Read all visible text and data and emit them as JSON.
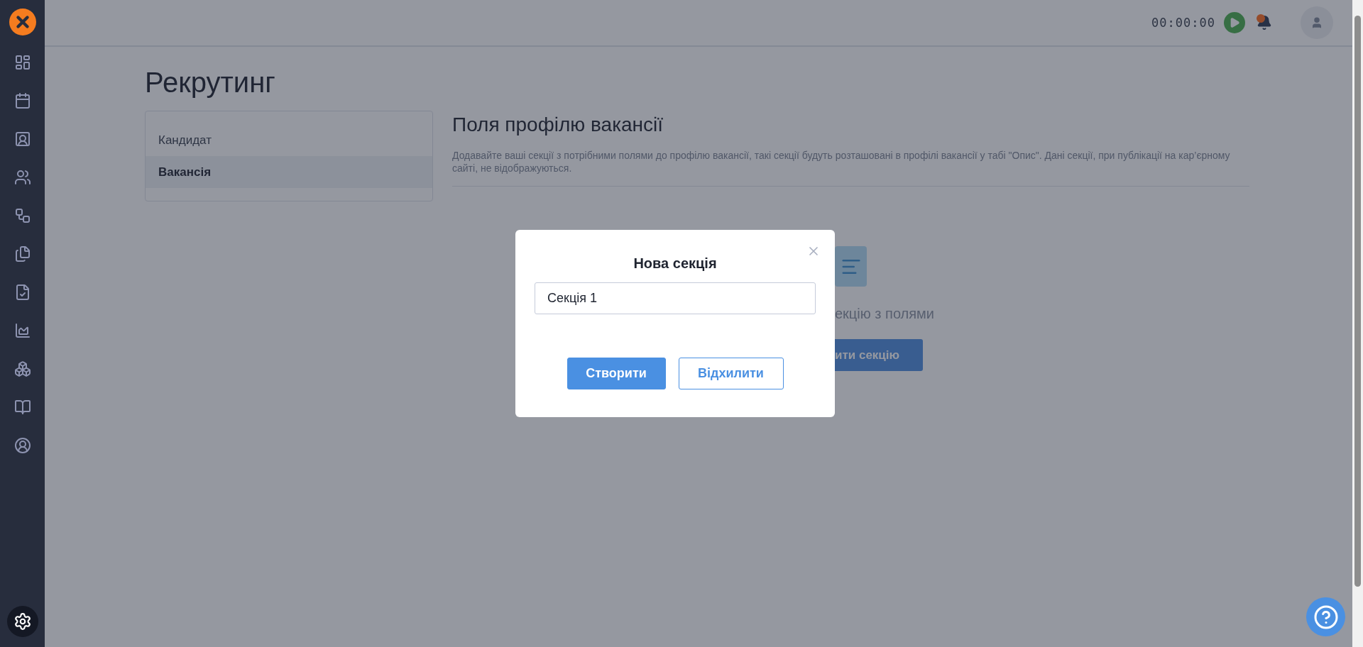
{
  "topbar": {
    "timer": "00:00:00"
  },
  "page": {
    "title": "Рекрутинг"
  },
  "tabs": [
    {
      "label": "Кандидат",
      "selected": false
    },
    {
      "label": "Вакансія",
      "selected": true
    }
  ],
  "section": {
    "heading": "Поля профілю вакансії",
    "description": "Додавайте ваші секції з потрібними полями до профілю вакансії, такі секції будуть розташовані в профілі вакансії у табі \"Опис\". Дані секції, при публікації на кар’єрному сайті, не відображуються."
  },
  "empty_state": {
    "text": "екцію з полями",
    "button": "ити секцію"
  },
  "modal": {
    "title": "Нова секція",
    "input": {
      "value": "Секція 1"
    },
    "buttons": [
      {
        "label": "Створити",
        "kind": "primary"
      },
      {
        "label": "Відхилити",
        "kind": "secondary"
      }
    ]
  }
}
